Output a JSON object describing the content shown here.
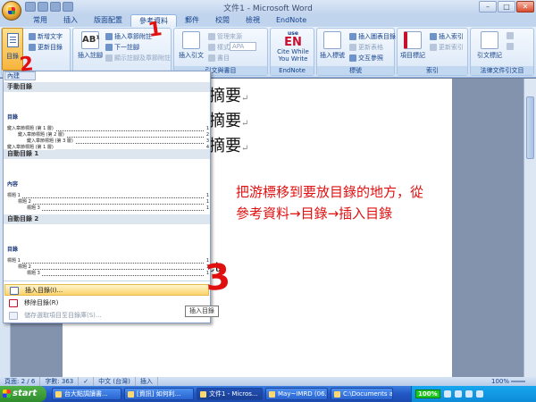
{
  "window": {
    "title": "文件1 - Microsoft Word",
    "controls": {
      "minimize": "–",
      "maximize": "□",
      "close": "✕"
    }
  },
  "tabs": [
    "常用",
    "插入",
    "版面配置",
    "參考資料",
    "郵件",
    "校閱",
    "檢視",
    "EndNote"
  ],
  "ribbon": {
    "toc_group": {
      "toc_button": "目錄",
      "add_text": "新增文字",
      "update_toc": "更新目錄"
    },
    "footnotes_group": {
      "insert_footnote": "插入註腳",
      "insert_endnote": "插入章節附註",
      "next_footnote": "下一註腳",
      "show_notes": "顯示註腳及章節附註"
    },
    "citations_group": {
      "insert_citation": "插入引文",
      "manage_sources": "管理來源",
      "style_label": "樣式",
      "style_value": "APA",
      "bibliography": "書目",
      "label": "引文與書目"
    },
    "endnote_group": {
      "logo_top": "use",
      "logo": "EN",
      "cite_while": "Cite While",
      "you_write": "You Write",
      "label": "EndNote"
    },
    "captions_group": {
      "insert_caption": "插入標號",
      "insert_table_figures": "插入圖表目錄",
      "update_table": "更新表格",
      "cross_ref": "交互參照",
      "label": "標號"
    },
    "index_group": {
      "mark_entry": "項目標記",
      "insert_index": "插入索引",
      "update_index": "更新索引",
      "label": "索引"
    },
    "toa_group": {
      "mark_citation": "引文標記",
      "label": "法律文件引文目"
    }
  },
  "dropdown": {
    "top_label": "內建",
    "manual_header": "手動目錄",
    "manual_preview": {
      "title": "目錄",
      "entries": [
        {
          "text": "鍵入章節標題 (第 1 層)",
          "num": "1"
        },
        {
          "text": "鍵入章節標題 (第 2 層)",
          "num": "2"
        },
        {
          "text": "鍵入章節標題 (第 3 層)",
          "num": "3"
        },
        {
          "text": "鍵入章節標題 (第 1 層)",
          "num": "4"
        }
      ]
    },
    "auto1_header": "自動目錄 1",
    "auto1_preview": {
      "title": "內容",
      "entries": [
        {
          "text": "標題 1",
          "num": "1"
        },
        {
          "text": "標題 2",
          "num": "1"
        },
        {
          "text": "標題 3",
          "num": "1"
        }
      ]
    },
    "auto2_header": "自動目錄 2",
    "auto2_preview": {
      "title": "目錄",
      "entries": [
        {
          "text": "標題 1",
          "num": "1"
        },
        {
          "text": "標題 2",
          "num": "1"
        },
        {
          "text": "標題 3",
          "num": "1"
        }
      ]
    },
    "insert_toc": "插入目錄(I)...",
    "remove_toc": "移除目錄(R)",
    "save_selection": "儲存選取項目至目錄庫(S)..."
  },
  "tooltip": "插入目錄",
  "document": {
    "lines": [
      "摘要",
      "摘要",
      "摘要"
    ],
    "fragment": "ct"
  },
  "annotation": {
    "line1": "把游標移到要放目錄的地方，從",
    "line2": "參考資料→目錄→插入目錄",
    "step1": "1",
    "step2": "2",
    "step3": "3"
  },
  "status_bar": {
    "page": "頁面: 2 / 6",
    "words": "字數: 363",
    "language": "中文 (台灣)",
    "mode": "插入",
    "zoom": "100%"
  },
  "taskbar": {
    "start": "start",
    "tasks": [
      "台大點調讀書...",
      "[資訊] 如何利...",
      "文件1 - Micros...",
      "May~IMRD (06...",
      "C:\\Documents a..."
    ],
    "tray_percent": "100%"
  },
  "colors": {
    "annotation_red": "#e01010",
    "ribbon_blue": "#15428b",
    "highlight": "#fbd36a",
    "taskbar_blue": "#2257c4"
  }
}
